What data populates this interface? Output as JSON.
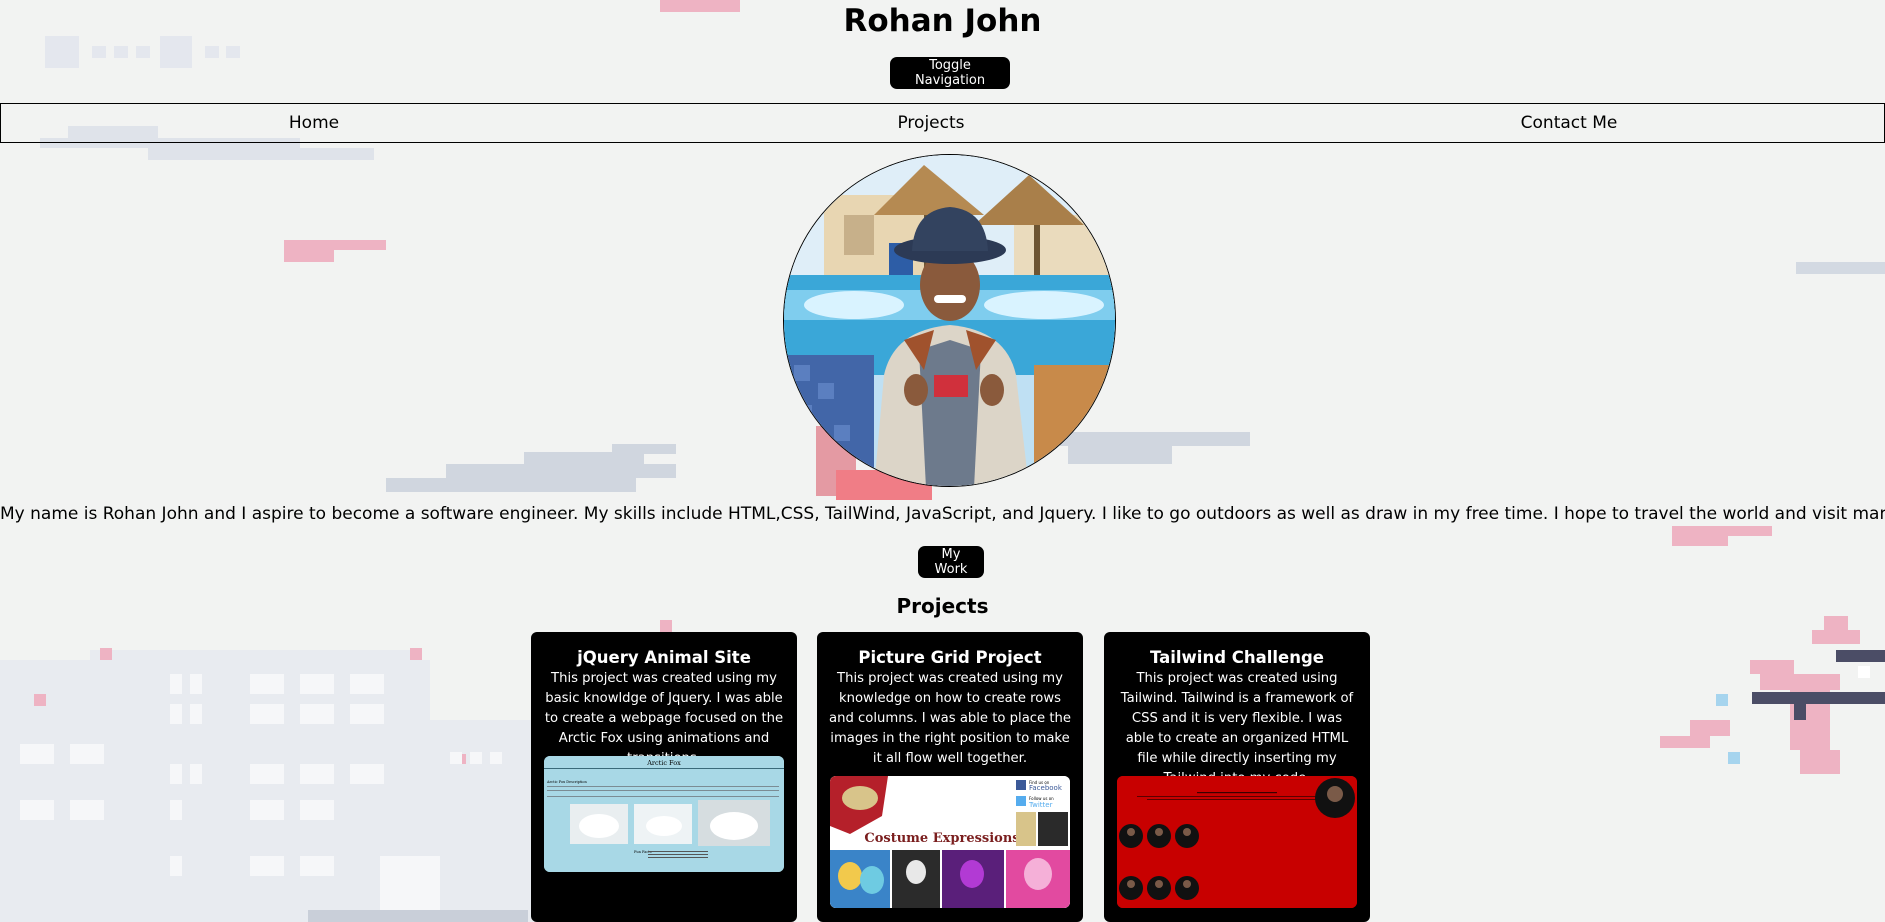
{
  "header": {
    "title": "Rohan John",
    "toggle_label": "Toggle Navigation"
  },
  "nav": {
    "items": [
      {
        "label": "Home"
      },
      {
        "label": "Projects"
      },
      {
        "label": "Contact Me"
      }
    ]
  },
  "about": {
    "photo_alt": "Profile photo of Rohan John by a pool",
    "bio": "My name is Rohan John and I aspire to become a software engineer. My skills include HTML,CSS, TailWind, JavaScript, and Jquery. I like to go outdoors as well as draw in my free time. I hope to travel the world and visit many cool places when I get older.",
    "my_work_label": "My Work"
  },
  "projects": {
    "heading": "Projects",
    "cards": [
      {
        "title": "jQuery Animal Site",
        "description": "This project was created using my basic knowldge of Jquery. I was able to create a webpage focused on the Arctic Fox using animations and transitions.",
        "preview_heading": "Arctic Fox",
        "preview_subheading": "Arctic Fox Description",
        "preview_footer": "Fun Facts"
      },
      {
        "title": "Picture Grid Project",
        "description": "This project was created using my knowledge on how to create rows and columns. I was able to place the images in the right position to make it all flow well together.",
        "preview_banner": "Costume Expressions",
        "preview_find_us": "Find us on",
        "preview_facebook": "Facebook",
        "preview_follow": "Follow us on",
        "preview_twitter": "Twitter"
      },
      {
        "title": "Tailwind Challenge",
        "description": "This project was created using Tailwind. Tailwind is a framework of CSS and it is very flexible. I was able to create an organized HTML file while directly inserting my Tailwind into my code."
      }
    ]
  },
  "colors": {
    "background": "#f2f3f2",
    "button_bg": "#000000",
    "button_text": "#ffffff",
    "card_bg": "#000000",
    "tailwind_preview_red": "#c80000",
    "jquery_preview_blue": "#a8d8e6",
    "pixel_pink": "#e8a4b8",
    "pixel_gray": "#c9cfd9"
  }
}
